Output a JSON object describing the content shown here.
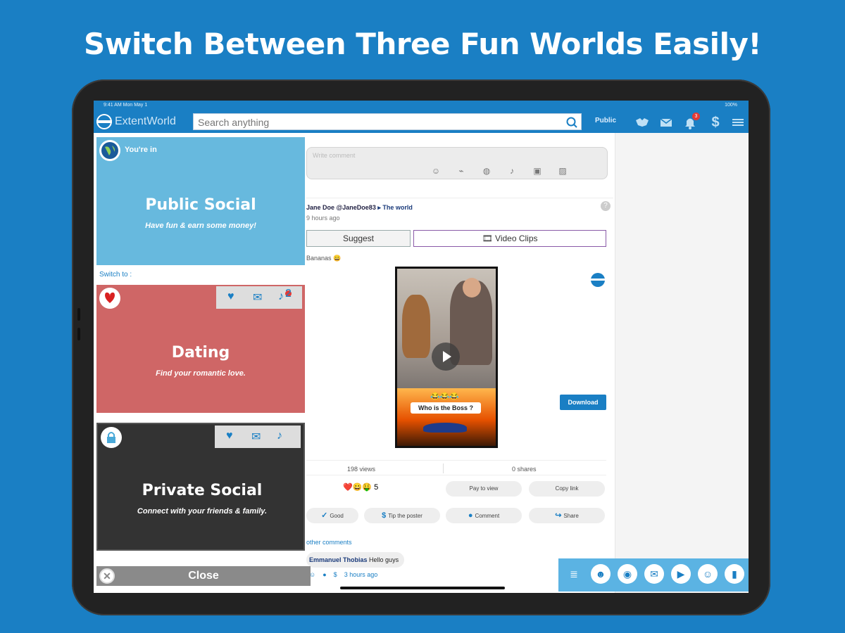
{
  "headline": "Switch Between Three Fun Worlds Easily!",
  "statusbar": {
    "left": "9:41 AM  Mon May 1",
    "right": "100%"
  },
  "topbar": {
    "logo": "ExtentWorld",
    "search_placeholder": "Search anything",
    "world_label": "Public",
    "notif_count": "3",
    "dollar": "$"
  },
  "composer": {
    "placeholder": "Write comment"
  },
  "post": {
    "author": "Jane Doe @JaneDoe83",
    "place": "▸ The world",
    "time": "9 hours ago",
    "tab_suggest": "Suggest",
    "tab_clips": "🎞 Video Clips",
    "caption": "Bananas 😀",
    "video_emojis": "😂😂😂",
    "video_text": "Who is the Boss ?",
    "download": "Download",
    "views": "198 views",
    "shares": "0 shares",
    "reactions": "❤️😀🤑 5",
    "pay_to_view": "Pay to view",
    "copy_link": "Copy link",
    "good": "Good",
    "tip": "Tip the poster",
    "comment": "Comment",
    "share": "Share",
    "other_comments": "other comments",
    "commenter": "Emmanuel Thobias",
    "comment_text": "Hello guys",
    "comment_time": "3 hours ago"
  },
  "switcher": {
    "youre_in": "You're in",
    "switch_to": "Switch to :",
    "close": "Close",
    "worlds": [
      {
        "title": "Public Social",
        "subtitle": "Have fun & earn some money!",
        "color": "#67b9de"
      },
      {
        "title": "Dating",
        "subtitle": "Find your romantic love.",
        "color": "#cf6666",
        "badge": "2"
      },
      {
        "title": "Private Social",
        "subtitle": "Connect with your friends & family.",
        "color": "#333333"
      }
    ]
  },
  "colors": {
    "background": "#1a7fc4",
    "accent": "#1a7fc4"
  }
}
